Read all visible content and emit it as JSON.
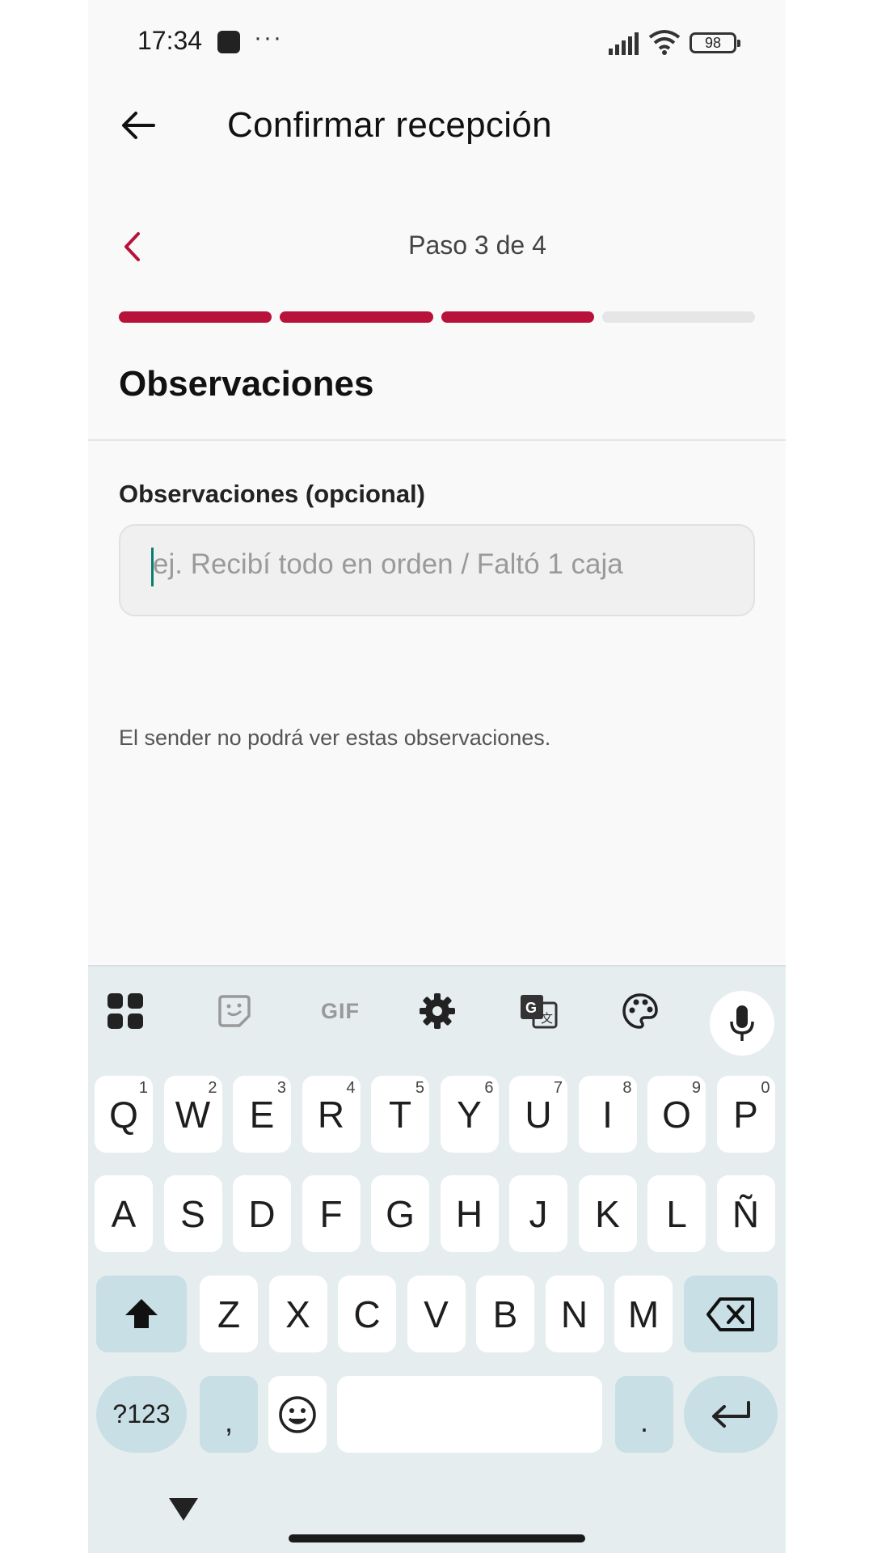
{
  "status_bar": {
    "time": "17:34",
    "dots": "···",
    "battery": "98"
  },
  "header": {
    "title": "Confirmar recepción"
  },
  "stepper": {
    "label": "Paso 3 de 4",
    "current_step": 3,
    "total_steps": 4
  },
  "section": {
    "title": "Observaciones"
  },
  "form": {
    "label": "Observaciones (opcional)",
    "value": "",
    "placeholder": "ej. Recibí todo en orden / Faltó 1 caja"
  },
  "hint": "El sender no podrá ver estas observaciones.",
  "keyboard": {
    "toolbar": {
      "gif_label": "GIF"
    },
    "row1": [
      {
        "k": "Q",
        "h": "1"
      },
      {
        "k": "W",
        "h": "2"
      },
      {
        "k": "E",
        "h": "3"
      },
      {
        "k": "R",
        "h": "4"
      },
      {
        "k": "T",
        "h": "5"
      },
      {
        "k": "Y",
        "h": "6"
      },
      {
        "k": "U",
        "h": "7"
      },
      {
        "k": "I",
        "h": "8"
      },
      {
        "k": "O",
        "h": "9"
      },
      {
        "k": "P",
        "h": "0"
      }
    ],
    "row2": [
      "A",
      "S",
      "D",
      "F",
      "G",
      "H",
      "J",
      "K",
      "L",
      "Ñ"
    ],
    "row3": [
      "Z",
      "X",
      "C",
      "V",
      "B",
      "N",
      "M"
    ],
    "symbols_label": "?123",
    "comma_label": ",",
    "period_label": "."
  },
  "colors": {
    "accent": "#b8123b",
    "keyboard_bg": "#e6edef",
    "special_key": "#c7dfe5"
  }
}
